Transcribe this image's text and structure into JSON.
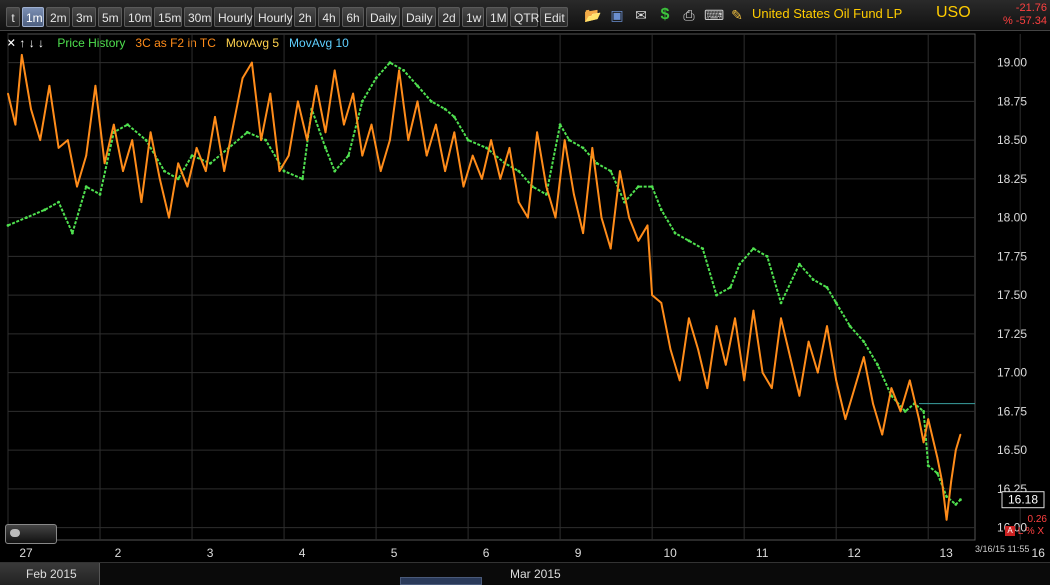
{
  "toolbar": {
    "buttons": [
      "t",
      "1m",
      "2m",
      "3m",
      "5m",
      "10m",
      "15m",
      "30m",
      "Hourly",
      "Hourly",
      "2h",
      "4h",
      "6h",
      "Daily",
      "Daily",
      "2d",
      "1w",
      "1M",
      "QTR",
      "Edit"
    ],
    "active_index": 1,
    "symbol_name": "United States Oil Fund LP",
    "symbol": "USO",
    "change": "-21.76",
    "change_pct": "% -57.34",
    "icons": [
      "open-folder-icon",
      "save-icon",
      "email-icon",
      "dollar-icon",
      "print-icon",
      "keyboard-icon",
      "pencil-icon"
    ]
  },
  "legend": {
    "items": [
      {
        "label": "Price History",
        "color": "#4fe04f"
      },
      {
        "label": "3C as F2 in TC",
        "color": "#ff8c1a"
      },
      {
        "label": "MovAvg 5",
        "color": "#ffd24d"
      },
      {
        "label": "MovAvg 10",
        "color": "#5fd0ff"
      }
    ],
    "arrows": "✕ ↑ ↓ ↓"
  },
  "bottom": {
    "left_label": "Feb 2015",
    "mid_label": "Mar 2015",
    "timestamp": "3/16/15 11:55",
    "side_value": "0.26",
    "side_text": "L % X"
  },
  "chart_data": {
    "type": "line",
    "ylim": [
      15.92,
      19.12
    ],
    "y_ticks": [
      "19.00",
      "18.75",
      "18.50",
      "18.25",
      "18.00",
      "17.75",
      "17.50",
      "17.25",
      "17.00",
      "16.75",
      "16.50",
      "16.25",
      "16.00"
    ],
    "y_tick_values": [
      19.0,
      18.75,
      18.5,
      18.25,
      18.0,
      17.75,
      17.5,
      17.25,
      17.0,
      16.75,
      16.5,
      16.25,
      16.0
    ],
    "x_ticks": [
      "27",
      "2",
      "3",
      "4",
      "5",
      "6",
      "9",
      "10",
      "11",
      "12",
      "13",
      "16"
    ],
    "last_price": "16.18",
    "ref_level": 16.8,
    "series": [
      {
        "name": "Price History",
        "color": "#4fe04f",
        "points": [
          [
            0.0,
            17.95
          ],
          [
            0.2,
            18.0
          ],
          [
            0.4,
            18.05
          ],
          [
            0.55,
            18.1
          ],
          [
            0.7,
            17.9
          ],
          [
            0.85,
            18.2
          ],
          [
            1.0,
            18.15
          ],
          [
            1.15,
            18.55
          ],
          [
            1.3,
            18.6
          ],
          [
            1.5,
            18.5
          ],
          [
            1.7,
            18.3
          ],
          [
            1.85,
            18.25
          ],
          [
            2.0,
            18.4
          ],
          [
            2.2,
            18.35
          ],
          [
            2.4,
            18.45
          ],
          [
            2.6,
            18.55
          ],
          [
            2.8,
            18.5
          ],
          [
            3.0,
            18.3
          ],
          [
            3.2,
            18.25
          ],
          [
            3.3,
            18.7
          ],
          [
            3.45,
            18.45
          ],
          [
            3.55,
            18.3
          ],
          [
            3.7,
            18.4
          ],
          [
            3.85,
            18.75
          ],
          [
            4.0,
            18.9
          ],
          [
            4.15,
            19.0
          ],
          [
            4.3,
            18.95
          ],
          [
            4.45,
            18.85
          ],
          [
            4.6,
            18.75
          ],
          [
            4.75,
            18.7
          ],
          [
            4.85,
            18.65
          ],
          [
            5.0,
            18.5
          ],
          [
            5.2,
            18.45
          ],
          [
            5.4,
            18.35
          ],
          [
            5.55,
            18.3
          ],
          [
            5.7,
            18.2
          ],
          [
            5.85,
            18.15
          ],
          [
            6.0,
            18.6
          ],
          [
            6.1,
            18.5
          ],
          [
            6.25,
            18.45
          ],
          [
            6.4,
            18.35
          ],
          [
            6.55,
            18.3
          ],
          [
            6.7,
            18.1
          ],
          [
            6.85,
            18.2
          ],
          [
            7.0,
            18.2
          ],
          [
            7.1,
            18.05
          ],
          [
            7.25,
            17.9
          ],
          [
            7.4,
            17.85
          ],
          [
            7.55,
            17.8
          ],
          [
            7.7,
            17.5
          ],
          [
            7.85,
            17.55
          ],
          [
            7.95,
            17.7
          ],
          [
            8.1,
            17.8
          ],
          [
            8.25,
            17.75
          ],
          [
            8.4,
            17.45
          ],
          [
            8.6,
            17.7
          ],
          [
            8.75,
            17.6
          ],
          [
            8.9,
            17.55
          ],
          [
            9.0,
            17.45
          ],
          [
            9.15,
            17.3
          ],
          [
            9.3,
            17.2
          ],
          [
            9.45,
            17.05
          ],
          [
            9.6,
            16.85
          ],
          [
            9.75,
            16.75
          ],
          [
            9.85,
            16.8
          ],
          [
            9.95,
            16.75
          ],
          [
            10.0,
            16.4
          ],
          [
            10.1,
            16.35
          ],
          [
            10.2,
            16.2
          ],
          [
            10.3,
            16.15
          ],
          [
            10.35,
            16.18
          ]
        ]
      },
      {
        "name": "3C as F2 in TC",
        "color": "#ff8c1a",
        "points": [
          [
            0.0,
            18.8
          ],
          [
            0.08,
            18.6
          ],
          [
            0.15,
            19.05
          ],
          [
            0.25,
            18.7
          ],
          [
            0.35,
            18.5
          ],
          [
            0.45,
            18.85
          ],
          [
            0.55,
            18.45
          ],
          [
            0.65,
            18.5
          ],
          [
            0.75,
            18.2
          ],
          [
            0.85,
            18.4
          ],
          [
            0.95,
            18.85
          ],
          [
            1.05,
            18.35
          ],
          [
            1.15,
            18.6
          ],
          [
            1.25,
            18.3
          ],
          [
            1.35,
            18.5
          ],
          [
            1.45,
            18.1
          ],
          [
            1.55,
            18.55
          ],
          [
            1.65,
            18.25
          ],
          [
            1.75,
            18.0
          ],
          [
            1.85,
            18.35
          ],
          [
            1.95,
            18.2
          ],
          [
            2.05,
            18.45
          ],
          [
            2.15,
            18.3
          ],
          [
            2.25,
            18.65
          ],
          [
            2.35,
            18.3
          ],
          [
            2.45,
            18.6
          ],
          [
            2.55,
            18.9
          ],
          [
            2.65,
            19.0
          ],
          [
            2.75,
            18.5
          ],
          [
            2.85,
            18.8
          ],
          [
            2.95,
            18.3
          ],
          [
            3.05,
            18.4
          ],
          [
            3.15,
            18.75
          ],
          [
            3.25,
            18.5
          ],
          [
            3.35,
            18.85
          ],
          [
            3.45,
            18.55
          ],
          [
            3.55,
            18.95
          ],
          [
            3.65,
            18.6
          ],
          [
            3.75,
            18.8
          ],
          [
            3.85,
            18.4
          ],
          [
            3.95,
            18.6
          ],
          [
            4.05,
            18.3
          ],
          [
            4.15,
            18.5
          ],
          [
            4.25,
            18.95
          ],
          [
            4.35,
            18.5
          ],
          [
            4.45,
            18.75
          ],
          [
            4.55,
            18.4
          ],
          [
            4.65,
            18.6
          ],
          [
            4.75,
            18.3
          ],
          [
            4.85,
            18.55
          ],
          [
            4.95,
            18.2
          ],
          [
            5.05,
            18.4
          ],
          [
            5.15,
            18.25
          ],
          [
            5.25,
            18.5
          ],
          [
            5.35,
            18.25
          ],
          [
            5.45,
            18.45
          ],
          [
            5.55,
            18.1
          ],
          [
            5.65,
            18.0
          ],
          [
            5.75,
            18.55
          ],
          [
            5.85,
            18.2
          ],
          [
            5.95,
            18.0
          ],
          [
            6.05,
            18.5
          ],
          [
            6.15,
            18.15
          ],
          [
            6.25,
            17.9
          ],
          [
            6.35,
            18.45
          ],
          [
            6.45,
            18.0
          ],
          [
            6.55,
            17.8
          ],
          [
            6.65,
            18.3
          ],
          [
            6.75,
            18.0
          ],
          [
            6.85,
            17.85
          ],
          [
            6.95,
            17.95
          ],
          [
            7.0,
            17.5
          ],
          [
            7.1,
            17.45
          ],
          [
            7.2,
            17.15
          ],
          [
            7.3,
            16.95
          ],
          [
            7.4,
            17.35
          ],
          [
            7.5,
            17.15
          ],
          [
            7.6,
            16.9
          ],
          [
            7.7,
            17.3
          ],
          [
            7.8,
            17.05
          ],
          [
            7.9,
            17.35
          ],
          [
            8.0,
            16.95
          ],
          [
            8.1,
            17.4
          ],
          [
            8.2,
            17.0
          ],
          [
            8.3,
            16.9
          ],
          [
            8.4,
            17.35
          ],
          [
            8.5,
            17.1
          ],
          [
            8.6,
            16.85
          ],
          [
            8.7,
            17.2
          ],
          [
            8.8,
            17.0
          ],
          [
            8.9,
            17.3
          ],
          [
            9.0,
            16.95
          ],
          [
            9.1,
            16.7
          ],
          [
            9.2,
            16.9
          ],
          [
            9.3,
            17.1
          ],
          [
            9.4,
            16.8
          ],
          [
            9.5,
            16.6
          ],
          [
            9.6,
            16.9
          ],
          [
            9.7,
            16.75
          ],
          [
            9.8,
            16.95
          ],
          [
            9.9,
            16.7
          ],
          [
            9.95,
            16.55
          ],
          [
            10.0,
            16.7
          ],
          [
            10.1,
            16.45
          ],
          [
            10.15,
            16.3
          ],
          [
            10.2,
            16.05
          ],
          [
            10.25,
            16.3
          ],
          [
            10.3,
            16.5
          ],
          [
            10.35,
            16.6
          ]
        ]
      }
    ]
  }
}
